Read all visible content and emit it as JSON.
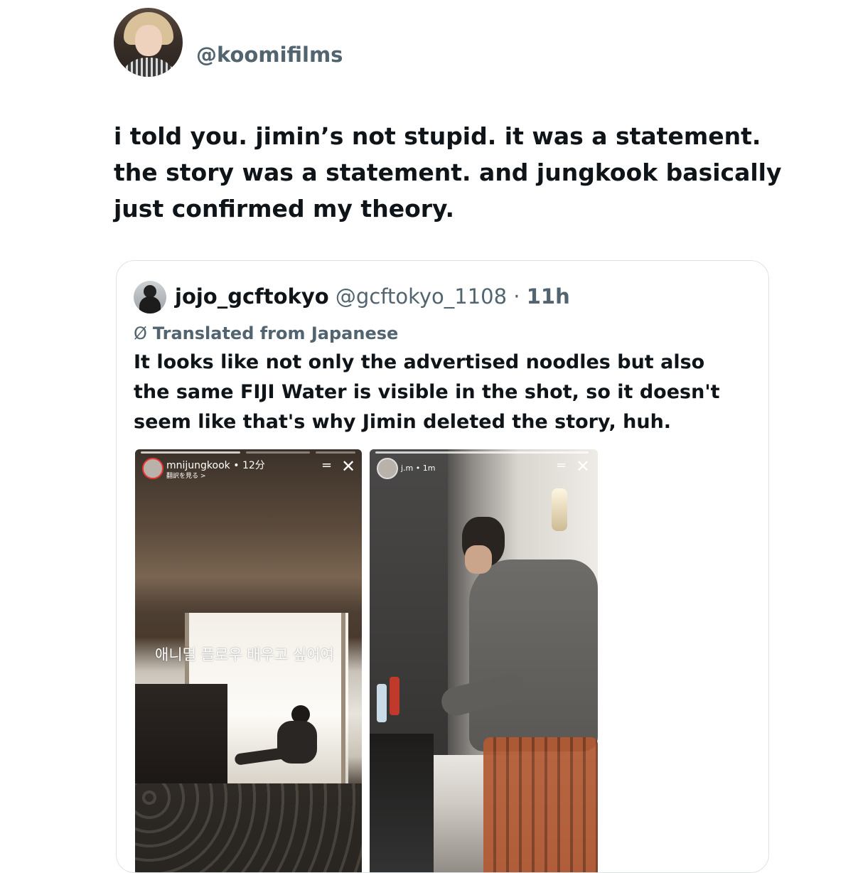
{
  "tweet": {
    "handle": "@koomifilms",
    "text": "i told you. jimin’s not stupid. it was a statement.\nthe story was a statement. and jungkook basically\njust confirmed my theory."
  },
  "quoted": {
    "display_name": "jojo_gcftokyo",
    "handle": "@gcftokyo_1108",
    "separator": "·",
    "time": "11h",
    "translated_label": "Translated from Japanese",
    "translated_icon": "translate-icon",
    "text": "It looks like not only the advertised noodles but also\nthe same FIJI Water is visible in the shot, so it doesn't\nseem like that's why Jimin deleted the story, huh.",
    "stories": [
      {
        "username": "mnijungkook",
        "time": "12分",
        "sub": "翻訳を見る >",
        "caption": "애니멀 플로우 배우고 싶어여",
        "close": "✕",
        "menu": "="
      },
      {
        "username": "j.m",
        "time": "1m",
        "close": "✕",
        "menu": "="
      }
    ]
  },
  "colors": {
    "text": "#0f1419",
    "secondary": "#536471",
    "border": "#dfe3e7"
  }
}
